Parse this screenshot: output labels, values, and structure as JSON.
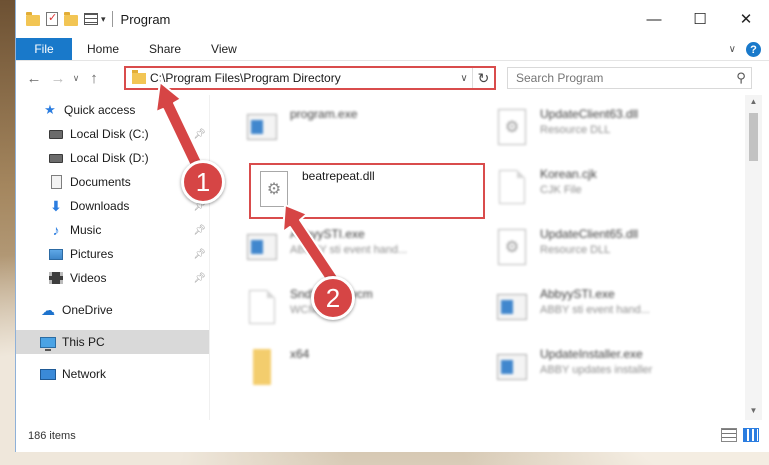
{
  "window": {
    "title": "Program",
    "controls": {
      "minimize": "—",
      "maximize": "☐",
      "close": "✕"
    }
  },
  "ribbon": {
    "file_tab": "File",
    "tabs": [
      "Home",
      "Share",
      "View"
    ],
    "help": "?"
  },
  "navigation": {
    "address": "C:\\Program Files\\Program Directory",
    "search_placeholder": "Search Program"
  },
  "sidebar": {
    "items": [
      {
        "label": "Quick access",
        "icon": "star-icon",
        "pinned": false
      },
      {
        "label": "Local Disk (C:)",
        "icon": "drive-icon",
        "pinned": true
      },
      {
        "label": "Local Disk (D:)",
        "icon": "drive-icon",
        "pinned": false
      },
      {
        "label": "Documents",
        "icon": "documents-icon",
        "pinned": false
      },
      {
        "label": "Downloads",
        "icon": "download-icon",
        "pinned": true
      },
      {
        "label": "Music",
        "icon": "music-icon",
        "pinned": true
      },
      {
        "label": "Pictures",
        "icon": "pictures-icon",
        "pinned": true
      },
      {
        "label": "Videos",
        "icon": "videos-icon",
        "pinned": true
      },
      {
        "label": "OneDrive",
        "icon": "onedrive-icon",
        "pinned": false
      },
      {
        "label": "This PC",
        "icon": "this-pc-icon",
        "pinned": false,
        "selected": true
      },
      {
        "label": "Network",
        "icon": "network-icon",
        "pinned": false
      }
    ]
  },
  "files": [
    {
      "name": "program.exe",
      "type": "",
      "icon": "program-exe-icon"
    },
    {
      "name": "UpdateClient63.dll",
      "type": "Resource DLL",
      "icon": "dll-gear-icon"
    },
    {
      "name": "beatrepeat.dll",
      "type": "",
      "icon": "dll-gear-icon"
    },
    {
      "name": "Korean.cjk",
      "type": "CJK File",
      "icon": "blank-file-icon"
    },
    {
      "name": "AbbyySTI.exe",
      "type": "ABBYY sti event hand...",
      "icon": "exe-window-icon"
    },
    {
      "name": "UpdateClient65.dll",
      "type": "Resource DLL",
      "icon": "dll-gear-icon"
    },
    {
      "name": "SndVol...5.wcm",
      "type": "WCM...",
      "icon": "blank-file-icon"
    },
    {
      "name": "AbbyySTI.exe",
      "type": "ABBY sti event hand...",
      "icon": "exe-window-icon"
    },
    {
      "name": "x64",
      "type": "",
      "icon": "folder-icon"
    },
    {
      "name": "UpdateInstaller.exe",
      "type": "ABBY updates installer",
      "icon": "exe-window-icon"
    }
  ],
  "status": {
    "item_count": "186 items"
  },
  "annotations": {
    "step1": "1",
    "step2": "2"
  },
  "colors": {
    "accent": "#1979ca",
    "highlight": "#d94c4c",
    "badge": "#d64545"
  }
}
